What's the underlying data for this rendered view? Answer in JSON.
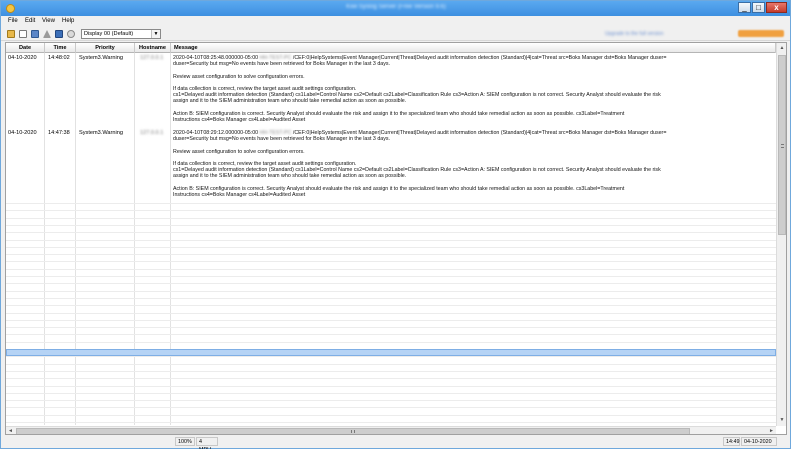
{
  "window": {
    "title": "Kiwi Syslog Server (Free Version 9.6)",
    "minimize": "_",
    "maximize": "□",
    "close": "x"
  },
  "menu": [
    "File",
    "Edit",
    "View",
    "Help"
  ],
  "toolbar": {
    "display_select": "Display 00 (Default)",
    "right_text": "Upgrade to the full version",
    "icons": [
      "open-icon",
      "edit-icon",
      "save-icon",
      "alert-icon",
      "view-icon",
      "help-icon"
    ]
  },
  "columns": [
    "Date",
    "Time",
    "Priority",
    "Hostname",
    "Message"
  ],
  "rows": [
    {
      "date": "04-10-2020",
      "time": "14:48:02",
      "priority": "System3.Warning",
      "hostname": "127.0.0.1",
      "message_head": "2020-04-10T08:25:48.000000-05:00",
      "message_host": "HH-TEST-PC",
      "message_lines": [
        "/CEF:0|HelpSystems|Event Manager|Current|Threat|Delayed audit information detection (Standard)|4|cat=Threat src=Boks Manager dst=Boks Manager duser=",
        "duser=Security but msg=No events have been retrieved for Boks Manager in the last 3 days."
      ],
      "paragraphs": [
        [
          "Review asset configuration to solve configuration errors."
        ],
        [
          "If data collection is correct, review the target asset audit settings configuration.",
          "cs1=Delayed audit information detection (Standard) cs1Label=Control Name cs2=Default cs2Label=Classification Rule cs3=Action A: SIEM configuration is not correct. Security Analyst should evaluate the risk",
          "assign and it to the SIEM administration team who should take remedial action as soon as possible."
        ],
        [
          "Action B: SIEM configuration is correct. Security Analyst should evaluate the risk and assign it to the specialized team who should take remedial action as soon as possible. cs3Label=Treatment",
          "Instructions cs4=Boks Manager cs4Label=Audited Asset"
        ]
      ]
    },
    {
      "date": "04-10-2020",
      "time": "14:47:38",
      "priority": "System3.Warning",
      "hostname": "127.0.0.1",
      "message_head": "2020-04-10T08:29:12.000000-05:00",
      "message_host": "HH-TEST-PC",
      "message_lines": [
        "/CEF:0|HelpSystems|Event Manager|Current|Threat|Delayed audit information detection (Standard)|4|cat=Threat src=Boks Manager dst=Boks Manager duser=",
        "duser=Security but msg=No events have been retrieved for Boks Manager in the last 3 days."
      ],
      "paragraphs": [
        [
          "Review asset configuration to solve configuration errors."
        ],
        [
          "If data collection is correct, review the target asset audit settings configuration.",
          "cs1=Delayed audit information detection (Standard) cs1Label=Control Name cs2=Default cs2Label=Classification Rule cs3=Action A: SIEM configuration is not correct. Security Analyst should evaluate the risk",
          "assign and it to the SIEM administration team who should take remedial action as soon as possible."
        ],
        [
          "Action B: SIEM configuration is correct. Security Analyst should evaluate the risk and assign it to the specialized team who should take remedial action as soon as possible. cs3Label=Treatment",
          "Instructions cs4=Boks Manager cs4Label=Audited Asset"
        ]
      ]
    }
  ],
  "scroll": {
    "up": "▲",
    "down": "▼",
    "left": "◄",
    "right": "►"
  },
  "status": {
    "zoom": "100%",
    "rate": "4 MPH",
    "time": "14:49",
    "date": "04-10-2020"
  },
  "colors": {
    "titlebar": "#3d8fe0",
    "selection": "#b5d3f5",
    "close": "#c43b2b"
  }
}
